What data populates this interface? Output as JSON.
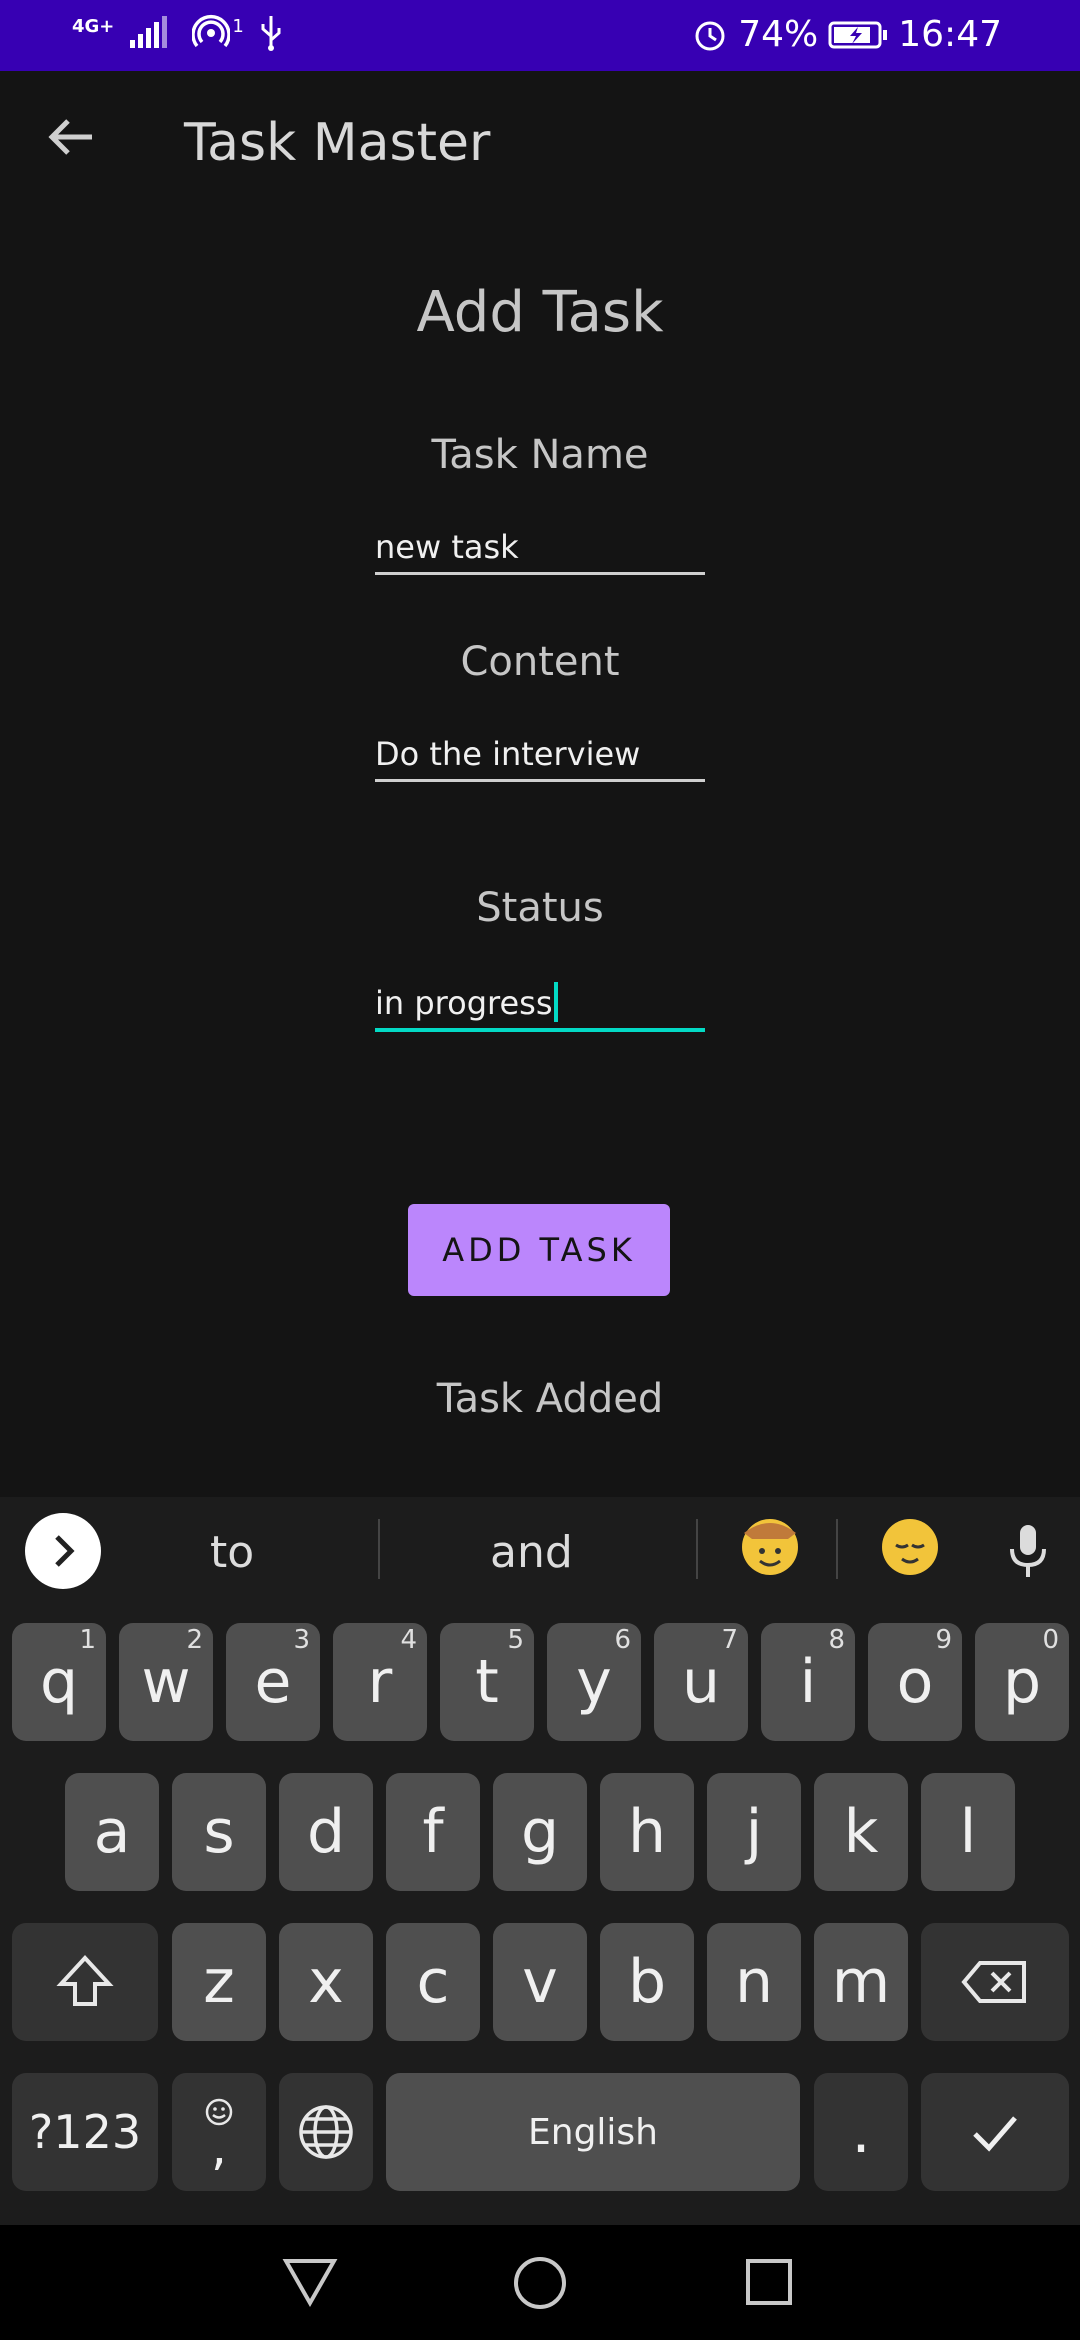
{
  "status_bar": {
    "network": "4G+",
    "sim_badge": "1",
    "battery": "74%",
    "time": "16:47"
  },
  "app": {
    "title": "Task Master"
  },
  "form": {
    "heading": "Add Task",
    "task_name_label": "Task Name",
    "task_name_value": "new task",
    "content_label": "Content",
    "content_value": "Do the interview",
    "status_label": "Status",
    "status_value": "in progress",
    "submit_label": "ADD TASK",
    "result_message": "Task Added"
  },
  "keyboard": {
    "suggestions": [
      "to",
      "and"
    ],
    "row1": [
      {
        "k": "q",
        "n": "1"
      },
      {
        "k": "w",
        "n": "2"
      },
      {
        "k": "e",
        "n": "3"
      },
      {
        "k": "r",
        "n": "4"
      },
      {
        "k": "t",
        "n": "5"
      },
      {
        "k": "y",
        "n": "6"
      },
      {
        "k": "u",
        "n": "7"
      },
      {
        "k": "i",
        "n": "8"
      },
      {
        "k": "o",
        "n": "9"
      },
      {
        "k": "p",
        "n": "0"
      }
    ],
    "row2": [
      "a",
      "s",
      "d",
      "f",
      "g",
      "h",
      "j",
      "k",
      "l"
    ],
    "row3": [
      "z",
      "x",
      "c",
      "v",
      "b",
      "n",
      "m"
    ],
    "symbols_label": "?123",
    "comma_label": ",",
    "space_label": "English",
    "period_label": "."
  },
  "colors": {
    "status_bar": "#3700b3",
    "background": "#141414",
    "accent": "#03dac5",
    "button": "#bb86fc"
  }
}
